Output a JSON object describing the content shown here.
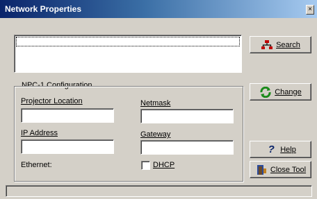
{
  "window": {
    "title": "Network Properties",
    "close_glyph": "×"
  },
  "group": {
    "label": "NPC-1 Configuration"
  },
  "fields": {
    "projector_location_label": "Projector Location",
    "projector_location_value": "",
    "netmask_label": "Netmask",
    "netmask_value": "",
    "ip_address_label": "IP Address",
    "ip_address_value": "",
    "gateway_label": "Gateway",
    "gateway_value": "",
    "ethernet_label": "Ethernet:"
  },
  "dhcp": {
    "label": "DHCP",
    "checked": false
  },
  "buttons": {
    "search": "Search",
    "change": "Change",
    "help": "Help",
    "close_tool": "Close Tool"
  },
  "icons": {
    "search": "network-search-icon",
    "change": "refresh-icon",
    "help": "question-mark-icon",
    "close_tool": "door-exit-icon"
  },
  "colors": {
    "titlebar_start": "#0a246a",
    "titlebar_end": "#a6caf0",
    "face": "#d4d0c8"
  }
}
